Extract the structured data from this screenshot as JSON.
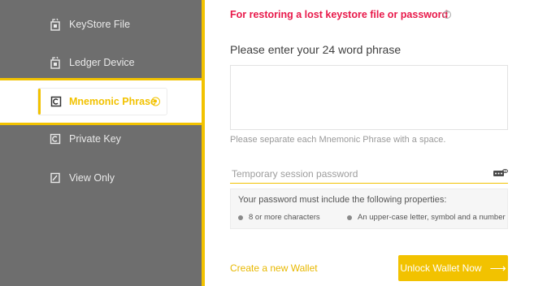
{
  "sidebar": {
    "items": [
      {
        "label": "KeyStore File",
        "icon": "keystore-file-icon"
      },
      {
        "label": "Ledger Device",
        "icon": "ledger-device-icon"
      },
      {
        "label": "Mnemonic Phrase",
        "icon": "mnemonic-phrase-icon",
        "active": true
      },
      {
        "label": "Private Key",
        "icon": "private-key-icon"
      },
      {
        "label": "View Only",
        "icon": "view-only-icon"
      }
    ],
    "accent": "#f2c200",
    "background": "#6e6e6e"
  },
  "main": {
    "heading": "For restoring a lost keystore file or password",
    "heading_color": "#e8194a",
    "phrase_title": "Please enter your 24 word phrase",
    "phrase_value": "",
    "phrase_hint": "Please separate each Mnemonic Phrase with a space.",
    "password": {
      "placeholder": "Temporary session password",
      "value": ""
    },
    "requirements": {
      "title": "Your password must include the following properties:",
      "items": [
        "8 or more characters",
        "An upper-case letter, symbol and a number"
      ]
    },
    "create_wallet_link": "Create a new Wallet",
    "unlock_button": "Unlock Wallet Now",
    "unlock_arrow": "⟶"
  }
}
